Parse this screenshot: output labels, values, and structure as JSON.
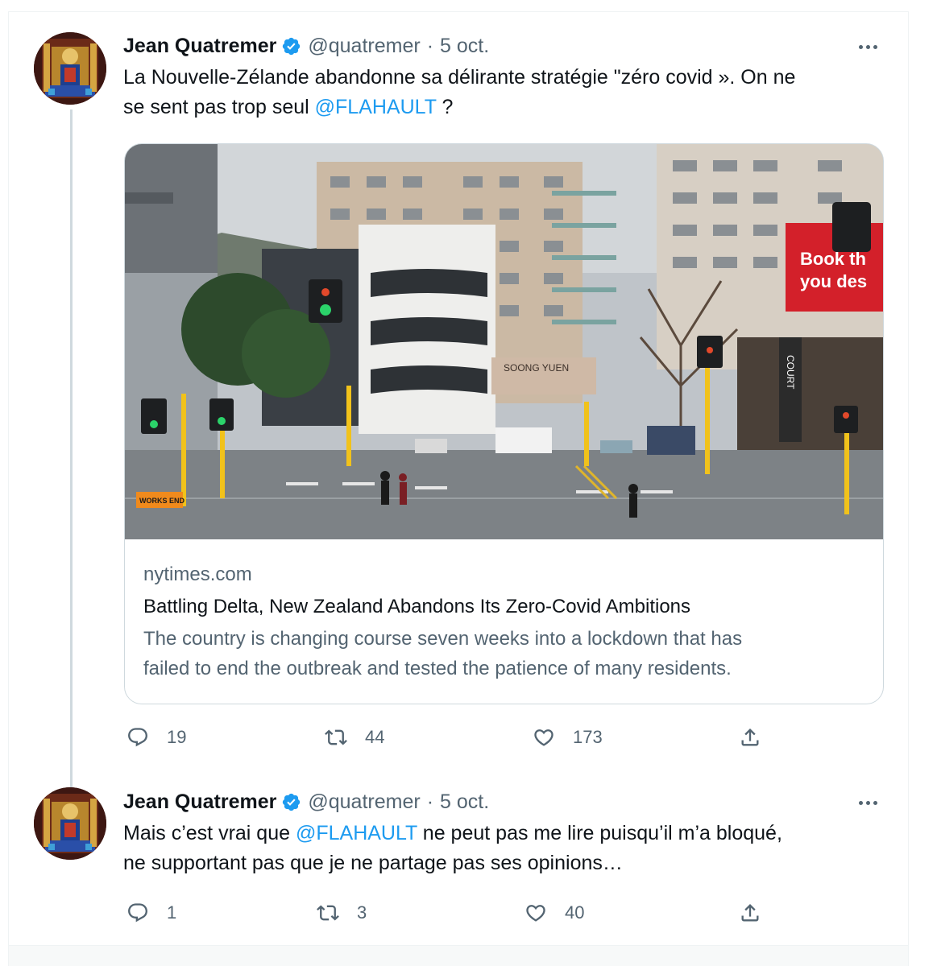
{
  "tweets": [
    {
      "author": {
        "name": "Jean Quatremer",
        "handle": "@quatremer",
        "dot": "·",
        "date": "5 oct."
      },
      "text": {
        "line1": "La Nouvelle-Zélande abandonne sa délirante stratégie \"zéro covid ». On ne",
        "line2_pre": "se sent pas trop seul ",
        "mention": "@FLAHAULT",
        "line2_post": " ?"
      },
      "card": {
        "domain": "nytimes.com",
        "title": "Battling Delta, New Zealand Abandons Its Zero-Covid Ambitions",
        "description_line1": "The country is changing course seven weeks into a lockdown that has",
        "description_line2": "failed to end the outbreak and tested the patience of many residents.",
        "image_signs": {
          "works": "WORKS END",
          "billboard_line1": "Book th",
          "billboard_line2": "you des",
          "court": "COURT",
          "shop": "SOONG YUEN"
        }
      },
      "actions": {
        "replies": "19",
        "retweets": "44",
        "likes": "173"
      }
    },
    {
      "author": {
        "name": "Jean Quatremer",
        "handle": "@quatremer",
        "dot": "·",
        "date": "5 oct."
      },
      "text": {
        "line1_pre": "Mais c’est vrai que ",
        "mention": "@FLAHAULT",
        "line1_post": " ne peut pas me lire puisqu’il m’a bloqué,",
        "line2": "ne supportant pas que je ne partage pas ses opinions…"
      },
      "actions": {
        "replies": "1",
        "retweets": "3",
        "likes": "40"
      }
    }
  ],
  "icons": {
    "verified": "verified-badge-icon",
    "more": "more-horizontal-icon",
    "reply": "reply-icon",
    "retweet": "retweet-icon",
    "like": "heart-icon",
    "share": "share-icon"
  },
  "colors": {
    "accent": "#1d9bf0",
    "text_primary": "#0f1419",
    "text_secondary": "#536471",
    "border": "#cfd9de"
  }
}
